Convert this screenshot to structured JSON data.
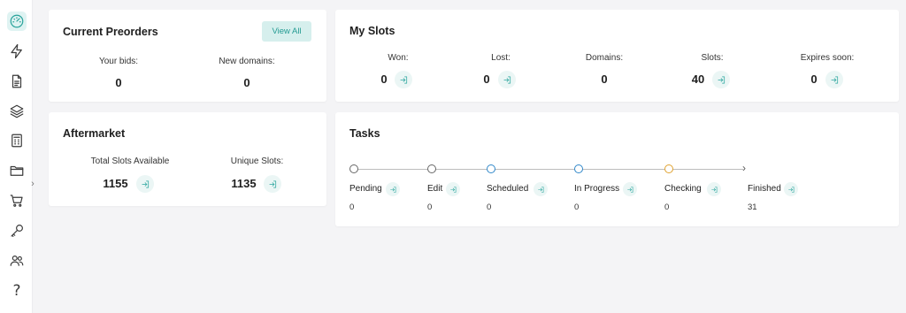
{
  "sidebar": {
    "items": [
      {
        "icon": "dashboard-gauge-icon",
        "active": true
      },
      {
        "icon": "lightning-icon",
        "active": false
      },
      {
        "icon": "document-icon",
        "active": false
      },
      {
        "icon": "layers-icon",
        "active": false
      },
      {
        "icon": "calculator-icon",
        "active": false
      },
      {
        "icon": "folder-icon",
        "active": false
      },
      {
        "icon": "cart-icon",
        "active": false
      },
      {
        "icon": "key-icon",
        "active": false
      },
      {
        "icon": "users-icon",
        "active": false
      },
      {
        "icon": "help-icon",
        "active": false
      }
    ],
    "help_glyph": "?",
    "collapse_glyph": "›"
  },
  "preorders": {
    "title": "Current Preorders",
    "view_all": "View All",
    "your_bids_label": "Your bids:",
    "your_bids_value": "0",
    "new_domains_label": "New domains:",
    "new_domains_value": "0"
  },
  "aftermarket": {
    "title": "Aftermarket",
    "total_label": "Total Slots Available",
    "total_value": "1155",
    "unique_label": "Unique Slots:",
    "unique_value": "1135"
  },
  "slots": {
    "title": "My Slots",
    "won_label": "Won:",
    "won_value": "0",
    "lost_label": "Lost:",
    "lost_value": "0",
    "domains_label": "Domains:",
    "domains_value": "0",
    "slots_label": "Slots:",
    "slots_value": "40",
    "expires_label": "Expires soon:",
    "expires_value": "0"
  },
  "tasks": {
    "title": "Tasks",
    "arrow_glyph": "›",
    "items": [
      {
        "label": "Pending",
        "count": "0",
        "color": "#666666"
      },
      {
        "label": "Edit",
        "count": "0",
        "color": "#666666"
      },
      {
        "label": "Scheduled",
        "count": "0",
        "color": "#2f87c9"
      },
      {
        "label": "In Progress",
        "count": "0",
        "color": "#2f87c9"
      },
      {
        "label": "Checking",
        "count": "0",
        "color": "#e0a22e"
      },
      {
        "label": "Finished",
        "count": "31"
      }
    ]
  },
  "colors": {
    "accent": "#29a39b",
    "accent_bg": "#d6efed",
    "background": "#f4f4f6"
  }
}
